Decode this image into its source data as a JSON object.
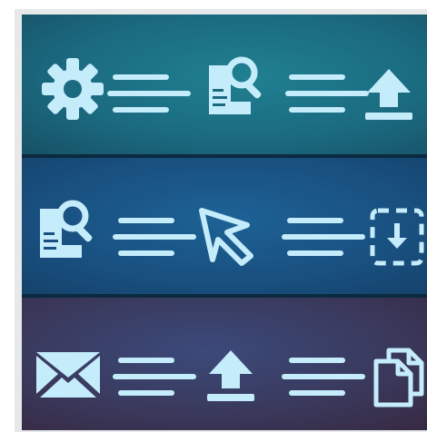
{
  "colors": {
    "frame_bg": "#e6e8ea",
    "icon_color": "#c5ecfb",
    "row_1_gradient": [
      "#1d5f78",
      "#1b7a88",
      "#196a7a"
    ],
    "row_2_gradient": [
      "#16466f",
      "#1c5b8c",
      "#184c78"
    ],
    "row_3_gradient": [
      "#3a2c48",
      "#3b4a7a",
      "#3a3552"
    ],
    "divider": "#0b2a3f"
  },
  "rows": [
    {
      "name": "row-1",
      "icons": [
        "gear-icon",
        "lines-icon",
        "document-search-icon",
        "lines-icon",
        "upload-icon"
      ]
    },
    {
      "name": "row-2",
      "icons": [
        "document-search-icon",
        "lines-icon",
        "cursor-icon",
        "lines-icon",
        "download-box-icon"
      ]
    },
    {
      "name": "row-3",
      "icons": [
        "envelope-icon",
        "lines-icon",
        "upload-icon",
        "lines-icon",
        "copy-documents-icon"
      ]
    }
  ]
}
